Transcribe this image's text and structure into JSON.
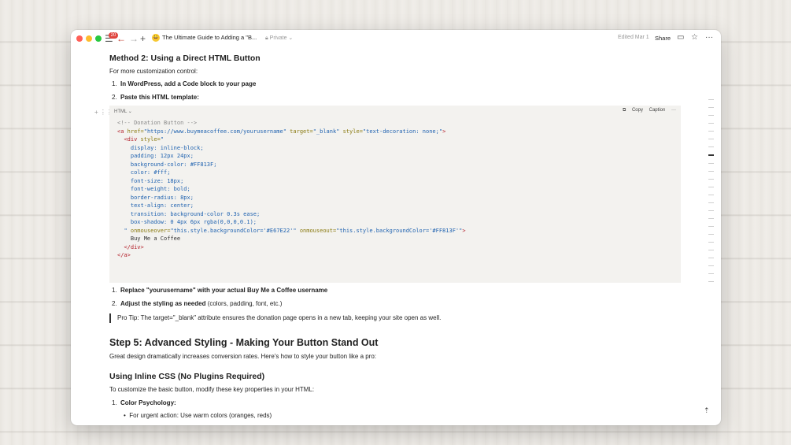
{
  "titlebar": {
    "badge_count": "20",
    "page_emoji": "😀",
    "page_title": "The Ultimate Guide to Adding a \"B...",
    "privacy": "Private",
    "edited": "Edited Mar 1",
    "share": "Share"
  },
  "doc": {
    "method2_heading": "Method 2: Using a Direct HTML Button",
    "intro": "For more customization control:",
    "list1": [
      {
        "num": "1.",
        "text": "In WordPress, add a Code block to your page"
      },
      {
        "num": "2.",
        "text": "Paste this HTML template:"
      }
    ],
    "code": {
      "language": "HTML",
      "copy_label": "Copy",
      "caption_label": "Caption",
      "more": "···"
    },
    "list2": [
      {
        "num": "1.",
        "bold": "Replace \"yourusername\" with your actual Buy Me a Coffee username",
        "rest": ""
      },
      {
        "num": "2.",
        "bold": "Adjust the styling as needed",
        "rest": " (colors, padding, font, etc.)"
      }
    ],
    "pro_tip": "Pro Tip: The target=\"_blank\" attribute ensures the donation page opens in a new tab, keeping your site open as well.",
    "step5_heading": "Step 5: Advanced Styling - Making Your Button Stand Out",
    "step5_intro": "Great design dramatically increases conversion rates. Here's how to style your button like a pro:",
    "inline_heading": "Using Inline CSS (No Plugins Required)",
    "inline_intro": "To customize the basic button, modify these key properties in your HTML:",
    "list3": [
      {
        "num": "1.",
        "text": "Color Psychology:"
      }
    ],
    "bullet1": "For urgent action: Use warm colors (oranges, reds)"
  }
}
